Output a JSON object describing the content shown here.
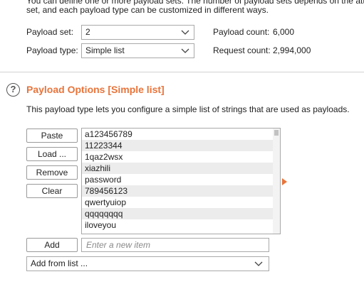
{
  "intro": {
    "line1": "You can define one or more payload sets. The number of payload sets depends on the atta",
    "line2": "set, and each payload type can be customized in different ways."
  },
  "payload_sets": {
    "set_label": "Payload set:",
    "set_value": "2",
    "type_label": "Payload type:",
    "type_value": "Simple list",
    "count_label": "Payload count:",
    "count_value": "6,000",
    "request_label": "Request count:",
    "request_value": "2,994,000"
  },
  "payload_options": {
    "help_icon": "?",
    "title": "Payload Options [Simple list]",
    "description": "This payload type lets you configure a simple list of strings that are used as payloads.",
    "buttons": {
      "paste": "Paste",
      "load": "Load ...",
      "remove": "Remove",
      "clear": "Clear",
      "add": "Add"
    },
    "items": [
      "a123456789",
      "11223344",
      "1qaz2wsx",
      "xiazhili",
      "password",
      "789456123",
      "qwertyuiop",
      "qqqqqqqq",
      "iloveyou"
    ],
    "new_item_placeholder": "Enter a new item",
    "add_from_list": "Add from list ..."
  },
  "icons": {
    "dropdown": "chevron-down-icon",
    "help": "help-circle-icon",
    "marker": "orange-triangle-icon"
  },
  "colors": {
    "accent": "#e8743b",
    "list_alt_row": "#ececec",
    "border": "#a9a9a9"
  }
}
